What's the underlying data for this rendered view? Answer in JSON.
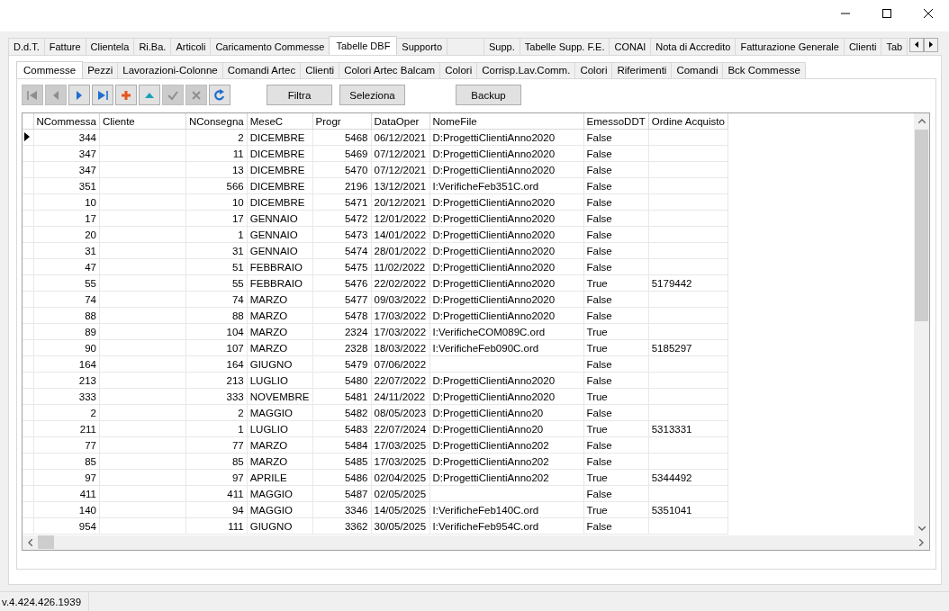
{
  "main_tabs": [
    {
      "label": "D.d.T.",
      "selected": false
    },
    {
      "label": "Fatture",
      "selected": false
    },
    {
      "label": "Clientela",
      "selected": false
    },
    {
      "label": "Ri.Ba.",
      "selected": false
    },
    {
      "label": "Articoli",
      "selected": false
    },
    {
      "label": "Caricamento Commesse",
      "selected": false
    },
    {
      "label": "Tabelle DBF",
      "selected": true
    },
    {
      "label": "Supporto",
      "selected": false
    },
    {
      "selected": false
    },
    {
      "label": "Supp.",
      "selected": false
    },
    {
      "label": "Tabelle Supp. F.E.",
      "selected": false
    },
    {
      "label": "CONAI",
      "selected": false
    },
    {
      "label": "Nota di Accredito",
      "selected": false
    },
    {
      "label": "Fatturazione Generale",
      "selected": false
    },
    {
      "label": "Clienti",
      "selected": false
    },
    {
      "label": "Tab",
      "selected": false
    }
  ],
  "sub_tabs": [
    {
      "label": "Commesse",
      "selected": true
    },
    {
      "label": "Pezzi",
      "selected": false
    },
    {
      "label": "Lavorazioni-Colonne",
      "selected": false
    },
    {
      "label": "Comandi Artec",
      "selected": false
    },
    {
      "label": "Clienti",
      "selected": false
    },
    {
      "label": "Colori Artec Balcam",
      "selected": false
    },
    {
      "label": "Colori",
      "selected": false
    },
    {
      "label": "Corrisp.Lav.Comm.",
      "selected": false
    },
    {
      "label": "Colori",
      "selected": false
    },
    {
      "label": "Riferimenti",
      "selected": false
    },
    {
      "label": "Comandi",
      "selected": false
    },
    {
      "label": "Bck Commesse",
      "selected": false
    }
  ],
  "navigator": [
    {
      "kind": "first",
      "disabled": true
    },
    {
      "kind": "prior",
      "disabled": true
    },
    {
      "kind": "next",
      "disabled": false
    },
    {
      "kind": "last",
      "disabled": false
    },
    {
      "kind": "insert",
      "disabled": false
    },
    {
      "kind": "up",
      "disabled": false
    },
    {
      "kind": "post",
      "disabled": true
    },
    {
      "kind": "cancel",
      "disabled": true
    },
    {
      "kind": "refresh",
      "disabled": false
    }
  ],
  "buttons": [
    "Filtra",
    "Seleziona",
    "Backup"
  ],
  "table": {
    "columns": [
      "NCommessa",
      "Cliente",
      "NConsegna",
      "MeseC",
      "Progr",
      "DataOper",
      "NomeFile",
      "EmessoDDT",
      "Ordine Acquisto"
    ],
    "rows": [
      {
        "current": true,
        "cells": [
          "344",
          null,
          "2",
          "DICEMBRE",
          "5468",
          "06/12/2021",
          "D:ProgettiClientiAnno2020",
          "False",
          null
        ]
      },
      {
        "current": false,
        "cells": [
          "347",
          null,
          "11",
          "DICEMBRE",
          "5469",
          "07/12/2021",
          "D:ProgettiClientiAnno2020",
          "False",
          null
        ]
      },
      {
        "current": false,
        "cells": [
          "347",
          null,
          "13",
          "DICEMBRE",
          "5470",
          "07/12/2021",
          "D:ProgettiClientiAnno2020",
          "False",
          null
        ]
      },
      {
        "current": false,
        "cells": [
          "351",
          null,
          "566",
          "DICEMBRE",
          "2196",
          "13/12/2021",
          "I:VerificheFeb351C.ord",
          "False",
          null
        ]
      },
      {
        "current": false,
        "cells": [
          "10",
          null,
          "10",
          "DICEMBRE",
          "5471",
          "20/12/2021",
          "D:ProgettiClientiAnno2020",
          "False",
          null
        ]
      },
      {
        "current": false,
        "cells": [
          "17",
          null,
          "17",
          "GENNAIO",
          "5472",
          "12/01/2022",
          "D:ProgettiClientiAnno2020",
          "False",
          null
        ]
      },
      {
        "current": false,
        "cells": [
          "20",
          null,
          "1",
          "GENNAIO",
          "5473",
          "14/01/2022",
          "D:ProgettiClientiAnno2020",
          "False",
          null
        ]
      },
      {
        "current": false,
        "cells": [
          "31",
          null,
          "31",
          "GENNAIO",
          "5474",
          "28/01/2022",
          "D:ProgettiClientiAnno2020",
          "False",
          null
        ]
      },
      {
        "current": false,
        "cells": [
          "47",
          null,
          "51",
          "FEBBRAIO",
          "5475",
          "11/02/2022",
          "D:ProgettiClientiAnno2020",
          "False",
          null
        ]
      },
      {
        "current": false,
        "cells": [
          "55",
          null,
          "55",
          "FEBBRAIO",
          "5476",
          "22/02/2022",
          "D:ProgettiClientiAnno2020",
          "True",
          "5179442"
        ]
      },
      {
        "current": false,
        "cells": [
          "74",
          null,
          "74",
          "MARZO",
          "5477",
          "09/03/2022",
          "D:ProgettiClientiAnno2020",
          "False",
          null
        ]
      },
      {
        "current": false,
        "cells": [
          "88",
          null,
          "88",
          "MARZO",
          "5478",
          "17/03/2022",
          "D:ProgettiClientiAnno2020",
          "False",
          null
        ]
      },
      {
        "current": false,
        "cells": [
          "89",
          null,
          "104",
          "MARZO",
          "2324",
          "17/03/2022",
          "I:VerificheCOM089C.ord",
          "True",
          null
        ]
      },
      {
        "current": false,
        "cells": [
          "90",
          null,
          "107",
          "MARZO",
          "2328",
          "18/03/2022",
          "I:VerificheFeb090C.ord",
          "True",
          "5185297"
        ]
      },
      {
        "current": false,
        "cells": [
          "164",
          null,
          "164",
          "GIUGNO",
          "5479",
          "07/06/2022",
          null,
          "False",
          null
        ]
      },
      {
        "current": false,
        "cells": [
          "213",
          null,
          "213",
          "LUGLIO",
          "5480",
          "22/07/2022",
          "D:ProgettiClientiAnno2020",
          "False",
          null
        ]
      },
      {
        "current": false,
        "cells": [
          "333",
          null,
          "333",
          "NOVEMBRE",
          "5481",
          "24/11/2022",
          "D:ProgettiClientiAnno2020",
          "True",
          null
        ]
      },
      {
        "current": false,
        "cells": [
          "2",
          null,
          "2",
          "MAGGIO",
          "5482",
          "08/05/2023",
          "D:ProgettiClientiAnno20",
          "False",
          null
        ]
      },
      {
        "current": false,
        "cells": [
          "211",
          null,
          "1",
          "LUGLIO",
          "5483",
          "22/07/2024",
          "D:ProgettiClientiAnno20",
          "True",
          "5313331"
        ]
      },
      {
        "current": false,
        "cells": [
          "77",
          null,
          "77",
          "MARZO",
          "5484",
          "17/03/2025",
          "D:ProgettiClientiAnno202",
          "False",
          null
        ]
      },
      {
        "current": false,
        "cells": [
          "85",
          null,
          "85",
          "MARZO",
          "5485",
          "17/03/2025",
          "D:ProgettiClientiAnno202",
          "False",
          null
        ]
      },
      {
        "current": false,
        "cells": [
          "97",
          null,
          "97",
          "APRILE",
          "5486",
          "02/04/2025",
          "D:ProgettiClientiAnno202",
          "True",
          "5344492"
        ]
      },
      {
        "current": false,
        "cells": [
          "411",
          null,
          "411",
          "MAGGIO",
          "5487",
          "02/05/2025",
          null,
          "False",
          null
        ]
      },
      {
        "current": false,
        "cells": [
          "140",
          null,
          "94",
          "MAGGIO",
          "3346",
          "14/05/2025",
          "I:VerificheFeb140C.ord",
          "True",
          "5351041"
        ]
      },
      {
        "current": false,
        "cells": [
          "954",
          null,
          "111",
          "GIUGNO",
          "3362",
          "30/05/2025",
          "I:VerificheFeb954C.ord",
          "False",
          null
        ]
      }
    ]
  },
  "status_bar": {
    "version": "v.4.424.426.1939"
  }
}
